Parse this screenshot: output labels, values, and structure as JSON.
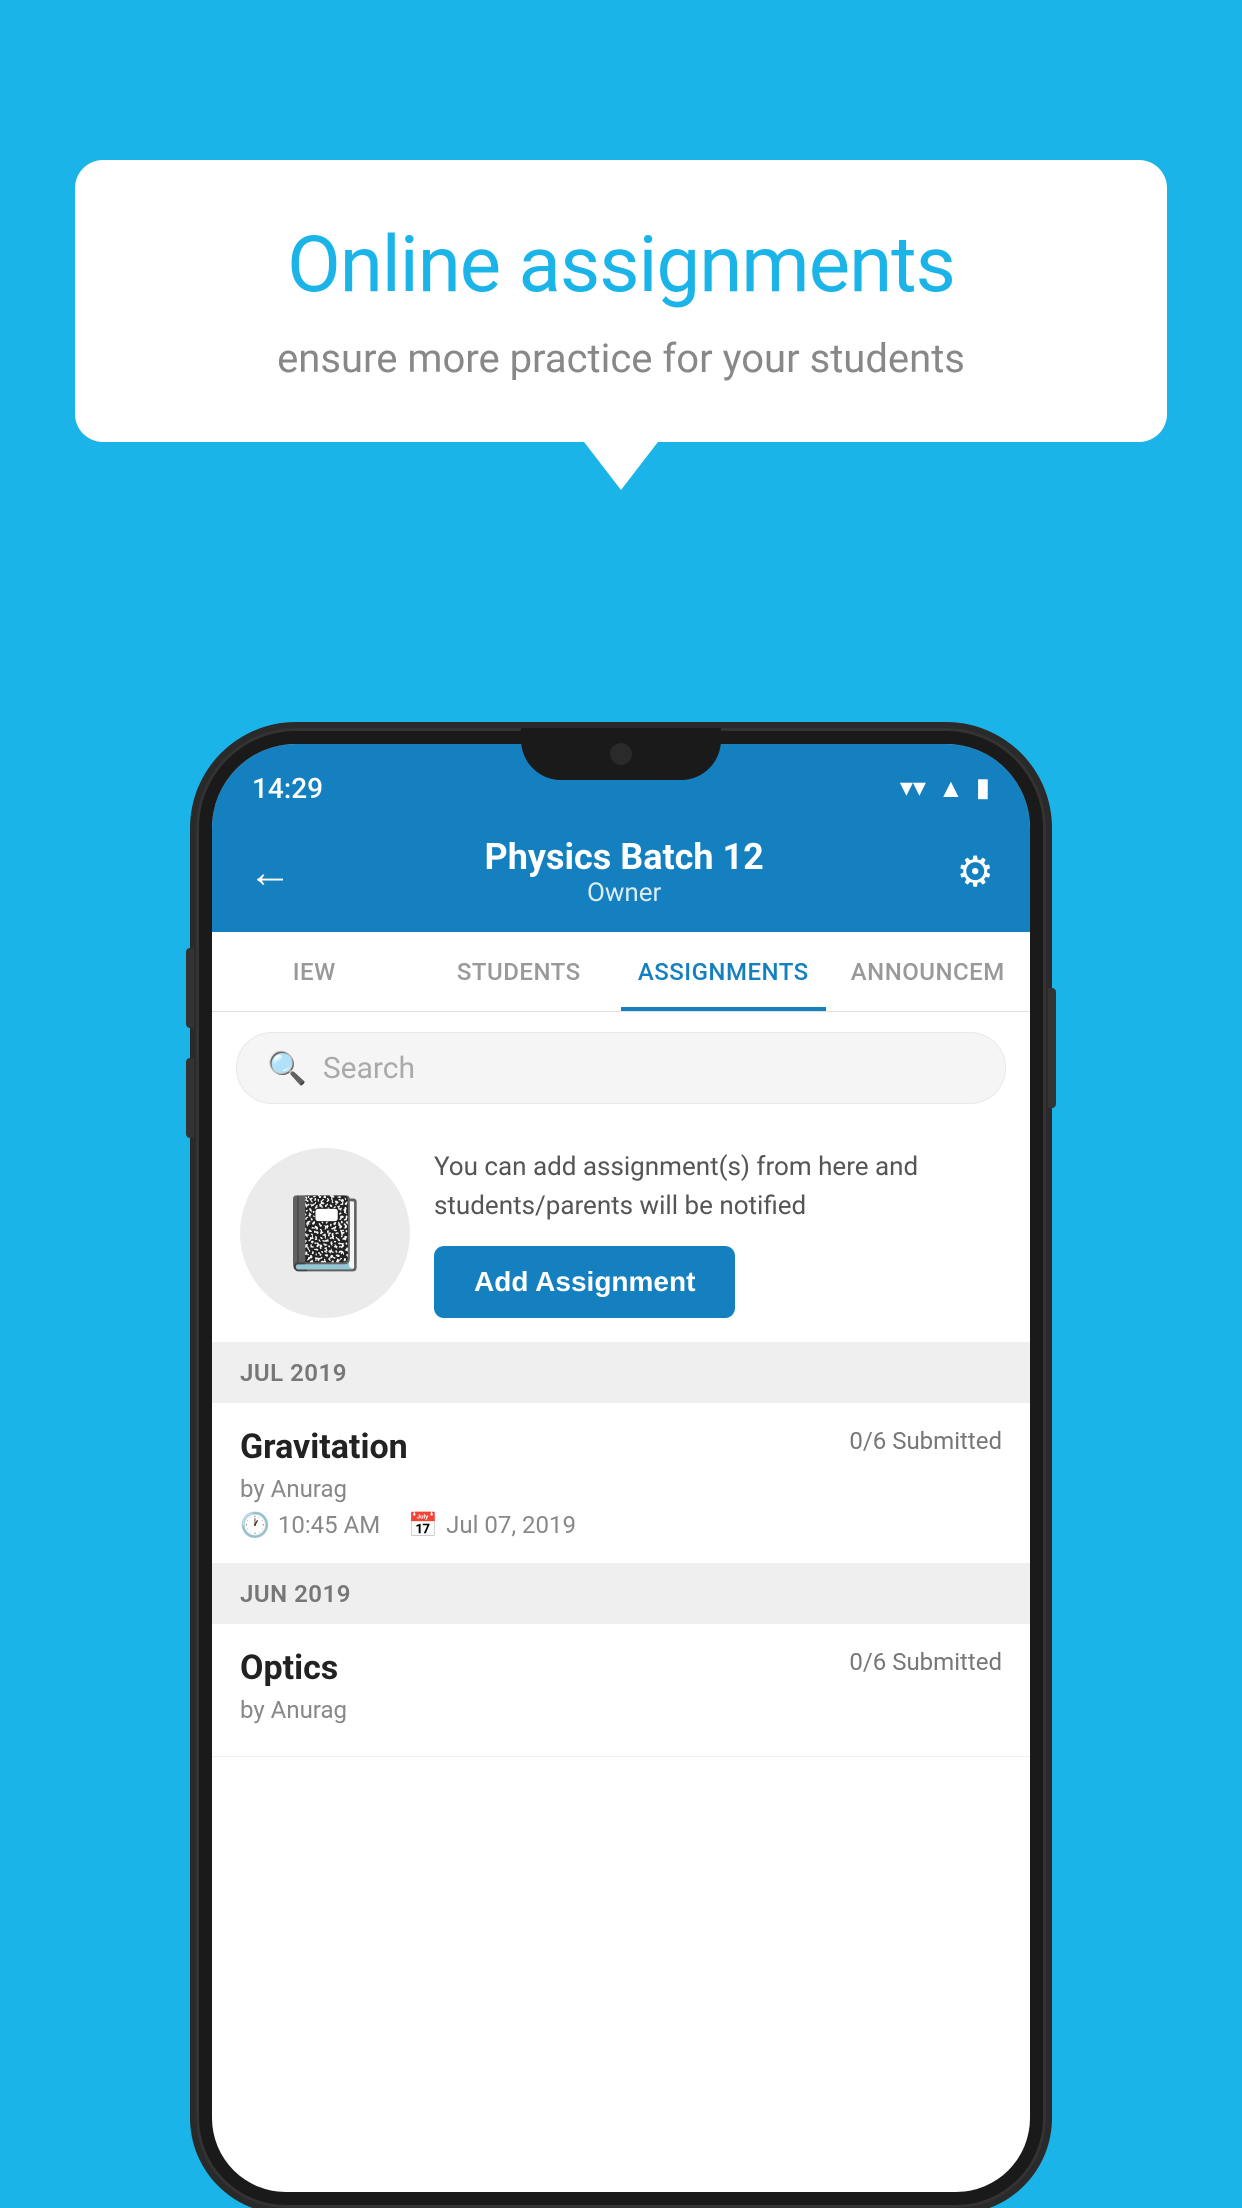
{
  "background_color": "#1ab4e8",
  "speech_bubble": {
    "title": "Online assignments",
    "subtitle": "ensure more practice for your students"
  },
  "phone": {
    "status_bar": {
      "time": "14:29",
      "wifi_icon": "▼",
      "signal_icon": "▲",
      "battery_icon": "▮"
    },
    "header": {
      "title": "Physics Batch 12",
      "subtitle": "Owner",
      "back_label": "←",
      "settings_label": "⚙"
    },
    "tabs": [
      {
        "label": "IEW",
        "active": false
      },
      {
        "label": "STUDENTS",
        "active": false
      },
      {
        "label": "ASSIGNMENTS",
        "active": true
      },
      {
        "label": "ANNOUNCEM",
        "active": false
      }
    ],
    "search": {
      "placeholder": "Search"
    },
    "promo": {
      "description": "You can add assignment(s) from here and students/parents will be notified",
      "button_label": "Add Assignment"
    },
    "sections": [
      {
        "header": "JUL 2019",
        "assignments": [
          {
            "name": "Gravitation",
            "submitted": "0/6 Submitted",
            "by": "by Anurag",
            "time": "10:45 AM",
            "date": "Jul 07, 2019"
          }
        ]
      },
      {
        "header": "JUN 2019",
        "assignments": [
          {
            "name": "Optics",
            "submitted": "0/6 Submitted",
            "by": "by Anurag",
            "time": "",
            "date": ""
          }
        ]
      }
    ]
  }
}
